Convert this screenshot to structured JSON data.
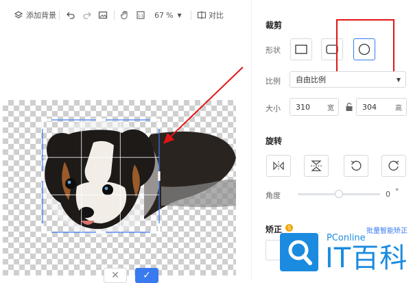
{
  "toolbar": {
    "add_background": "添加背景",
    "zoom": "67",
    "zoom_unit": "%",
    "compare": "对比"
  },
  "panel": {
    "crop_title": "裁剪",
    "shape_label": "形状",
    "ratio_label": "比例",
    "ratio_value": "自由比例",
    "size_label": "大小",
    "width": "310",
    "width_unit": "宽",
    "height": "304",
    "height_unit": "高",
    "rotate_title": "旋转",
    "angle_label": "角度",
    "angle_value": "0",
    "angle_unit": "°",
    "angle_fraction": 0.5,
    "correct_title": "矫正",
    "batch_correct": "批量智能矫正"
  },
  "watermark": {
    "brand_small": "PConline",
    "brand_large": "IT百科"
  },
  "colors": {
    "accent": "#3a7af0",
    "annotation": "#e31414",
    "logo_blue": "#1b8be0"
  }
}
